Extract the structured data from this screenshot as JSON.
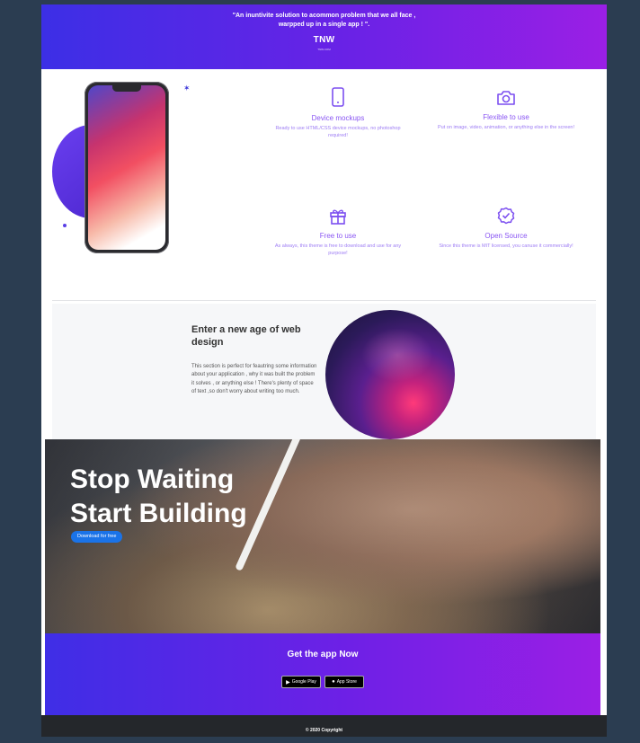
{
  "testimonial": {
    "quote": "\"An inuntivite solution to acommon problem that we all face , warpped up in a single app ! \".",
    "source": "TNW",
    "small": "TNW.COM"
  },
  "features": [
    {
      "icon": "phone-icon",
      "title": "Device mockups",
      "description": "Ready to use HTML/CSS device mockups, no photoshop required!"
    },
    {
      "icon": "camera-icon",
      "title": "Flexible to use",
      "description": "Put on image, video, animation, or anything else in the screen!"
    },
    {
      "icon": "gift-icon",
      "title": "Free to use",
      "description": "As always, this theme is free to download and use for any purpose!"
    },
    {
      "icon": "badge-check-icon",
      "title": "Open Source",
      "description": "Since this theme is MIT licensed, you canuse it commercially!"
    }
  ],
  "about": {
    "title": "Enter a new age of web design",
    "text": "This section is perfect for feautring some information about your application , why it was built the problem it solves , or anything else ! There's plenty of space of text ,so don't worry about writing too much."
  },
  "hero": {
    "line1": "Stop Waiting",
    "line2": "Start Building",
    "button": "Download for free"
  },
  "app": {
    "title": "Get the app Now",
    "google_play": "Google Play",
    "app_store": "App Store"
  },
  "footer": {
    "copyright": "© 2020 Copyright"
  },
  "colors": {
    "accent": "#7c4ff0",
    "gradient_start": "#3c2fe6",
    "gradient_end": "#9b1fe5",
    "button": "#1a73e8"
  }
}
